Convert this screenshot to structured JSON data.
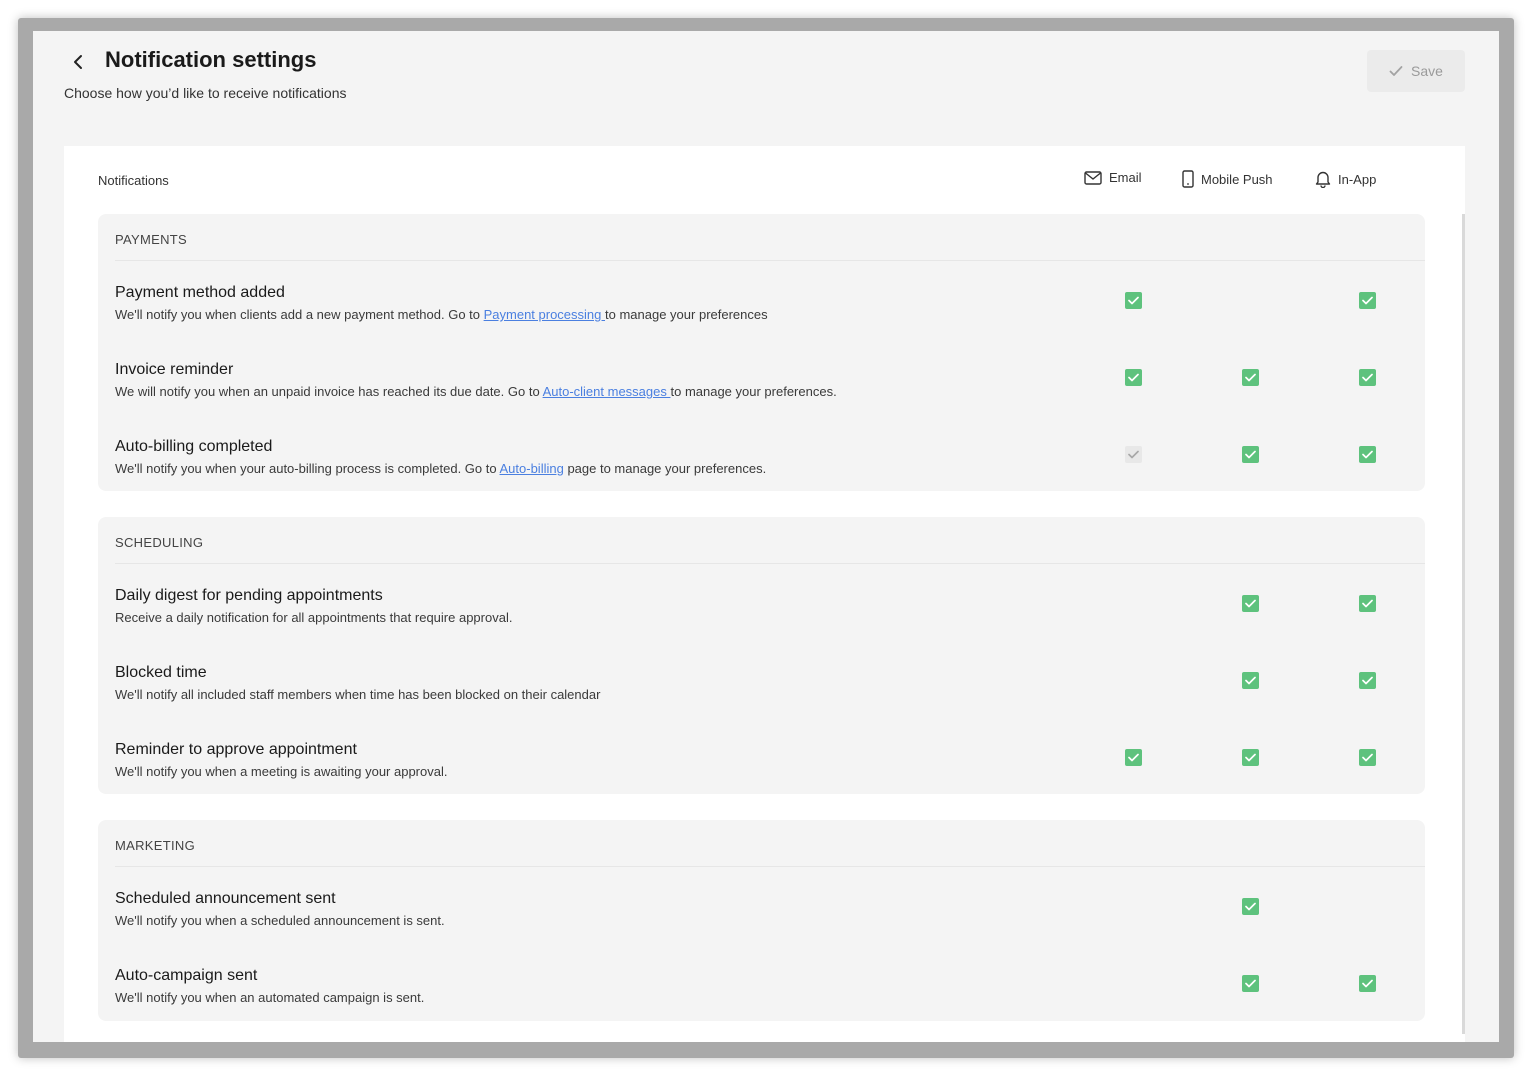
{
  "header": {
    "title": "Notification settings",
    "subtitle": "Choose how you’d like to receive notifications",
    "save_label": "Save"
  },
  "table": {
    "header_label": "Notifications",
    "columns": [
      {
        "key": "email",
        "label": "Email",
        "icon": "mail-icon"
      },
      {
        "key": "push",
        "label": "Mobile Push",
        "icon": "mobile-icon"
      },
      {
        "key": "inapp",
        "label": "In-App",
        "icon": "bell-icon"
      }
    ]
  },
  "colors": {
    "checked": "#5ec27d",
    "link": "#4a7fe0",
    "background": "#f4f4f4"
  },
  "sections": [
    {
      "title": "PAYMENTS",
      "rows": [
        {
          "title": "Payment method added",
          "desc_before": "We'll notify you when clients add a new payment method. Go to ",
          "link": "Payment processing ",
          "desc_after": "to manage your preferences",
          "email": "checked",
          "push": "none",
          "inapp": "checked"
        },
        {
          "title": "Invoice reminder",
          "desc_before": "We will notify you when an unpaid invoice has reached its due date. Go to ",
          "link": "Auto-client messages ",
          "desc_after": "to manage your preferences.",
          "email": "checked",
          "push": "checked",
          "inapp": "checked"
        },
        {
          "title": "Auto-billing completed",
          "desc_before": "We'll notify you when your auto-billing process is completed. Go to ",
          "link": "Auto-billing",
          "desc_after": " page to manage your preferences.",
          "email": "disabled",
          "push": "checked",
          "inapp": "checked"
        }
      ]
    },
    {
      "title": "SCHEDULING",
      "rows": [
        {
          "title": "Daily digest for pending appointments",
          "desc_before": "Receive a daily notification for all appointments that require approval.",
          "link": "",
          "desc_after": "",
          "email": "none",
          "push": "checked",
          "inapp": "checked"
        },
        {
          "title": "Blocked time",
          "desc_before": "We'll notify all included staff members when time has been blocked on their calendar",
          "link": "",
          "desc_after": "",
          "email": "none",
          "push": "checked",
          "inapp": "checked"
        },
        {
          "title": "Reminder to approve appointment",
          "desc_before": "We'll notify you when a meeting is awaiting your approval.",
          "link": "",
          "desc_after": "",
          "email": "checked",
          "push": "checked",
          "inapp": "checked"
        }
      ]
    },
    {
      "title": "MARKETING",
      "rows": [
        {
          "title": "Scheduled announcement sent",
          "desc_before": "We'll notify you when a scheduled announcement is sent.",
          "link": "",
          "desc_after": "",
          "email": "none",
          "push": "checked",
          "inapp": "unchecked"
        },
        {
          "title": "Auto-campaign sent",
          "desc_before": "We'll notify you when an automated campaign is sent.",
          "link": "",
          "desc_after": "",
          "email": "none",
          "push": "checked",
          "inapp": "checked"
        }
      ]
    }
  ]
}
